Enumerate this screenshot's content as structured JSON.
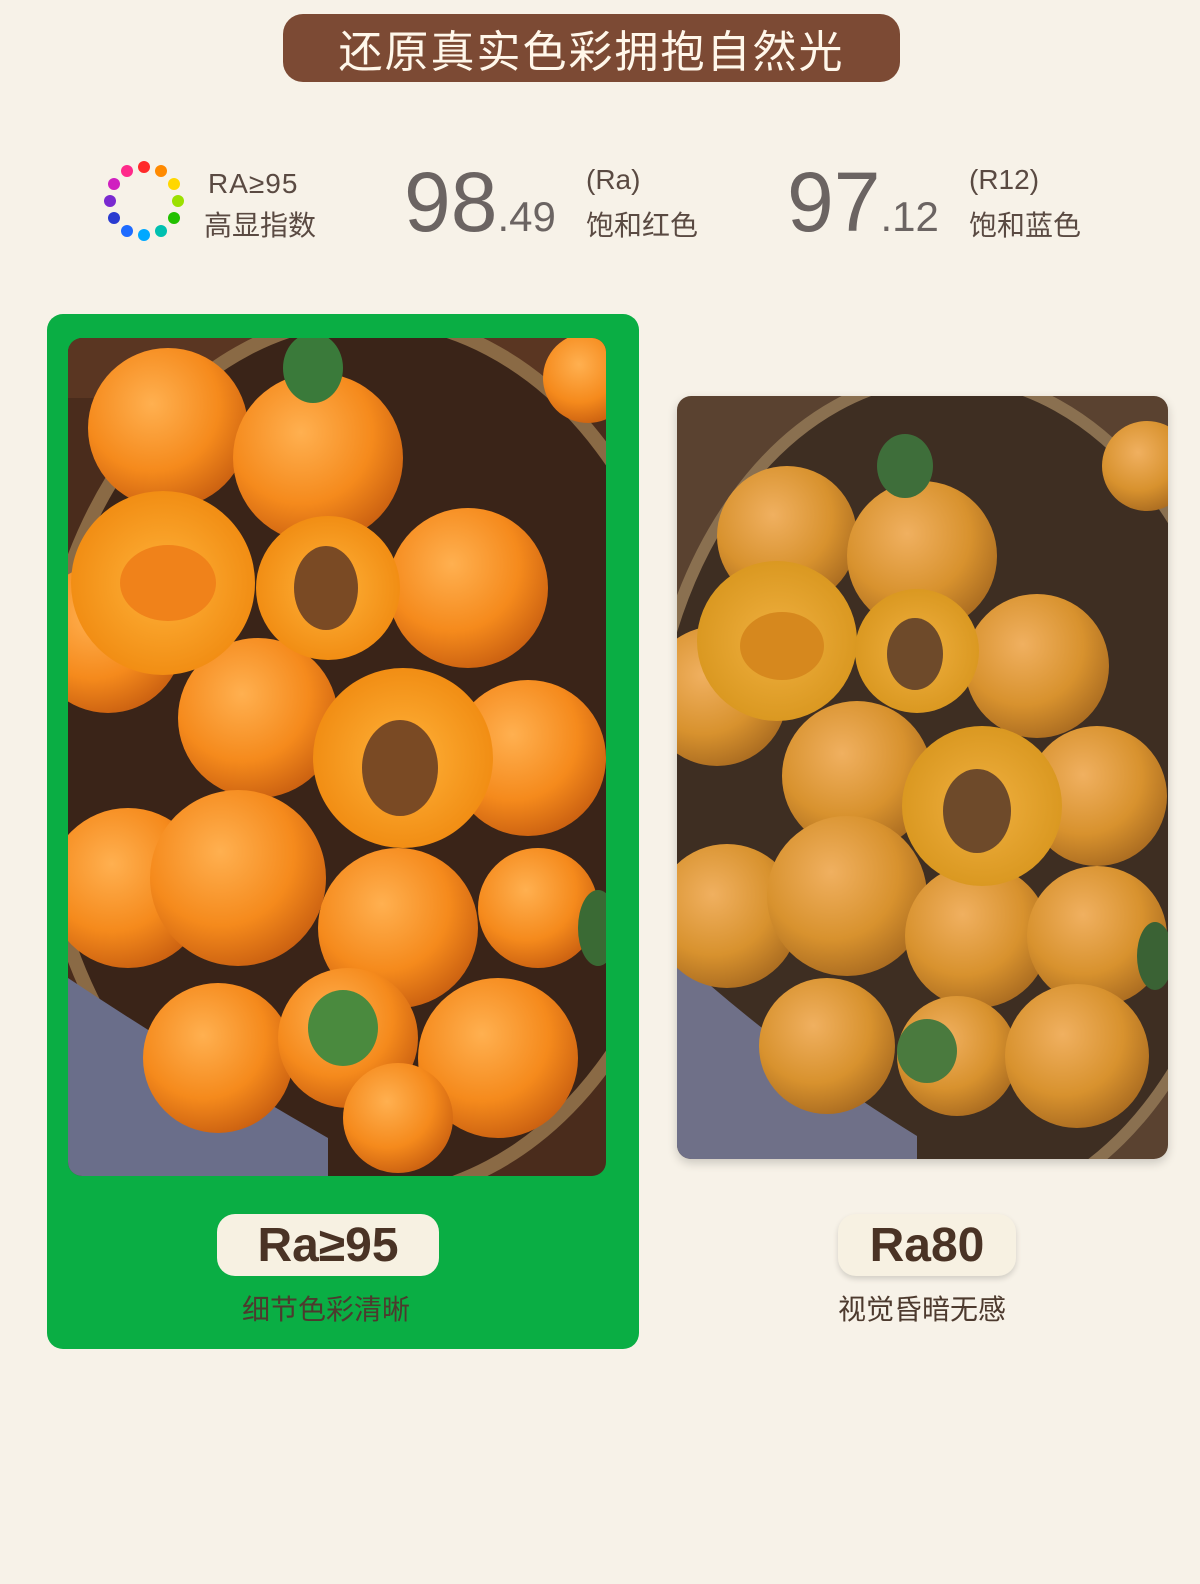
{
  "header": {
    "title": "还原真实色彩拥抱自然光"
  },
  "stats": {
    "ra_label": "RA≥95",
    "ra_caption": "高显指数",
    "value1_int": "98",
    "value1_dec": ".49",
    "value1_unit": "(Ra)",
    "value1_caption": "饱和红色",
    "value2_int": "97",
    "value2_dec": ".12",
    "value2_unit": "(R12)",
    "value2_caption": "饱和蓝色"
  },
  "comparison": {
    "left": {
      "badge": "Ra≥95",
      "caption": "细节色彩清晰"
    },
    "right": {
      "badge": "Ra80",
      "caption": "视觉昏暗无感"
    }
  },
  "colors": {
    "title_bg": "#7c4a34",
    "highlight_card": "#0aae44",
    "page_bg": "#f7f2e8",
    "badge_bg": "#f7f1e2"
  },
  "icons": {
    "color_ring": "color-ring-icon"
  }
}
